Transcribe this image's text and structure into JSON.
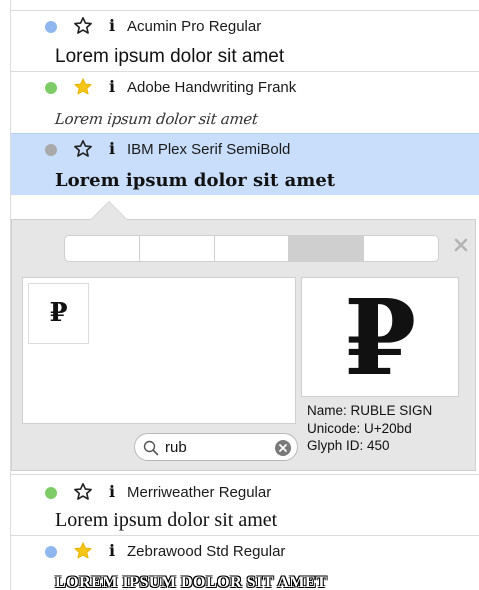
{
  "fonts": [
    {
      "name": "Acumin Pro Regular",
      "status_color": "#8fb6ee",
      "favorite": false,
      "sample": "Lorem ipsum dolor sit amet",
      "selected": false
    },
    {
      "name": "Adobe Handwriting Frank",
      "status_color": "#7dcc66",
      "favorite": true,
      "sample": "Lorem ipsum dolor sit amet",
      "selected": false
    },
    {
      "name": "IBM Plex Serif SemiBold",
      "status_color": "#a9a9a9",
      "favorite": false,
      "sample": "Lorem ipsum dolor sit amet",
      "selected": true
    },
    {
      "name": "Merriweather Regular",
      "status_color": "#7dcc66",
      "favorite": false,
      "sample": "Lorem ipsum dolor sit amet",
      "selected": false
    },
    {
      "name": "Zebrawood Std Regular",
      "status_color": "#8fb6ee",
      "favorite": true,
      "sample": "LOREM IPSUM DOLOR SIT AMET",
      "selected": false
    }
  ],
  "icons": {
    "info_glyph": "i",
    "star_filled_color": "#f5c518",
    "star_outline_color": "#222222"
  },
  "glyph_panel": {
    "grid": [
      {
        "char": "₽"
      }
    ],
    "preview_char": "₽",
    "name": "Name: RUBLE SIGN",
    "unicode": "Unicode: U+20bd",
    "glyph_id": "Glyph ID: 450",
    "segments_active_index": 3,
    "search": {
      "value": "rub",
      "placeholder": ""
    }
  }
}
